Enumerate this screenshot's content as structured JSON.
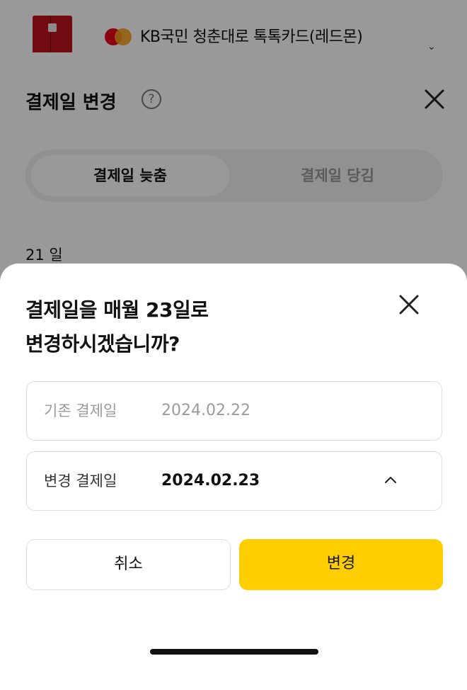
{
  "card": {
    "name": "KB국민 청춘대로 톡톡카드(레드몬)",
    "network_icon": "mastercard-logo",
    "chevron": "⌄",
    "accent": "#c0141c"
  },
  "back_sheet": {
    "title": "결제일 변경",
    "help_icon": "?",
    "tabs": [
      {
        "label": "결제일 늦춤",
        "active": true
      },
      {
        "label": "결제일 당김",
        "active": false
      }
    ],
    "day_label": "21 일"
  },
  "dialog": {
    "title_line1": "결제일을 매월 23일로",
    "title_line2": "변경하시겠습니까?",
    "current_field": {
      "label": "기존 결제일",
      "value": "2024.02.22"
    },
    "new_field": {
      "label": "변경 결제일",
      "value": "2024.02.23"
    },
    "cancel_label": "취소",
    "confirm_label": "변경",
    "confirm_color": "#ffcd00"
  }
}
